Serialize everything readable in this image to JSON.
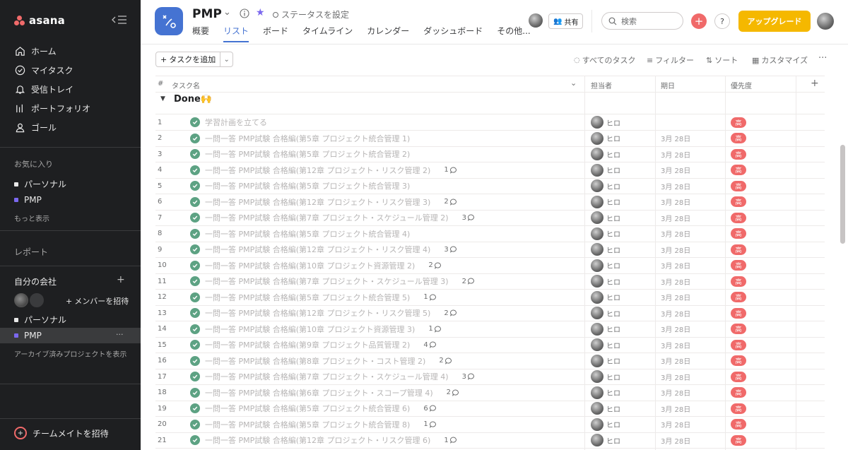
{
  "sidebar": {
    "logo_text": "asana",
    "nav": [
      {
        "label": "ホーム",
        "icon": "home-icon"
      },
      {
        "label": "マイタスク",
        "icon": "check-circle-icon"
      },
      {
        "label": "受信トレイ",
        "icon": "bell-icon"
      },
      {
        "label": "ポートフォリオ",
        "icon": "bar-chart-icon"
      },
      {
        "label": "ゴール",
        "icon": "person-icon"
      }
    ],
    "favorites_label": "お気に入り",
    "favorites": [
      {
        "label": "パーソナル",
        "color": "#e8e8e8"
      },
      {
        "label": "PMP",
        "color": "#7b68ee"
      }
    ],
    "show_more": "もっと表示",
    "reports_label": "レポート",
    "team_label": "自分の会社",
    "invite_member": "メンバーを招待",
    "team_projects": [
      {
        "label": "パーソナル",
        "color": "#e8e8e8"
      },
      {
        "label": "PMP",
        "color": "#7b68ee"
      }
    ],
    "archived_link": "アーカイブ済みプロジェクトを表示",
    "invite_teammates": "チームメイトを招待"
  },
  "header": {
    "project_title": "PMP",
    "status_label": "ステータスを設定",
    "tabs": [
      "概要",
      "リスト",
      "ボード",
      "タイムライン",
      "カレンダー",
      "ダッシュボード",
      "その他..."
    ],
    "active_tab": "リスト",
    "share_label": "共有",
    "search_placeholder": "検索",
    "help_label": "?",
    "upgrade_label": "アップグレード",
    "accent": "#4573d2",
    "upgrade_color": "#f5b800"
  },
  "toolbar": {
    "add_task": "タスクを追加",
    "all_tasks": "すべてのタスク",
    "filter": "フィルター",
    "sort": "ソート",
    "customize": "カスタマイズ",
    "more": "···"
  },
  "table": {
    "headers": {
      "num": "#",
      "name": "タスク名",
      "assignee": "担当者",
      "due": "期日",
      "priority": "優先度",
      "add": "+"
    },
    "section_name": "Done🙌",
    "rows": [
      {
        "num": "1",
        "name": "学習計画を立てる",
        "comments": "",
        "assignee": "ヒロ",
        "due": "",
        "priority": "高"
      },
      {
        "num": "2",
        "name": "一問一答 PMP試験 合格編(第5章 プロジェクト統合管理 1)",
        "comments": "",
        "assignee": "ヒロ",
        "due": "3月 28日",
        "priority": "高"
      },
      {
        "num": "3",
        "name": "一問一答 PMP試験 合格編(第5章 プロジェクト統合管理 2)",
        "comments": "",
        "assignee": "ヒロ",
        "due": "3月 28日",
        "priority": "高"
      },
      {
        "num": "4",
        "name": "一問一答 PMP試験 合格編(第12章 プロジェクト・リスク管理 2)",
        "comments": "1",
        "assignee": "ヒロ",
        "due": "3月 28日",
        "priority": "高"
      },
      {
        "num": "5",
        "name": "一問一答 PMP試験 合格編(第5章 プロジェクト統合管理 3)",
        "comments": "",
        "assignee": "ヒロ",
        "due": "3月 28日",
        "priority": "高"
      },
      {
        "num": "6",
        "name": "一問一答 PMP試験 合格編(第12章 プロジェクト・リスク管理 3)",
        "comments": "2",
        "assignee": "ヒロ",
        "due": "3月 28日",
        "priority": "高"
      },
      {
        "num": "7",
        "name": "一問一答 PMP試験 合格編(第7章 プロジェクト・スケジュール管理 2)",
        "comments": "3",
        "assignee": "ヒロ",
        "due": "3月 28日",
        "priority": "高"
      },
      {
        "num": "8",
        "name": "一問一答 PMP試験 合格編(第5章 プロジェクト統合管理 4)",
        "comments": "",
        "assignee": "ヒロ",
        "due": "3月 28日",
        "priority": "高"
      },
      {
        "num": "9",
        "name": "一問一答 PMP試験 合格編(第12章 プロジェクト・リスク管理 4)",
        "comments": "3",
        "assignee": "ヒロ",
        "due": "3月 28日",
        "priority": "高"
      },
      {
        "num": "10",
        "name": "一問一答 PMP試験 合格編(第10章 プロジェクト資源管理 2)",
        "comments": "2",
        "assignee": "ヒロ",
        "due": "3月 28日",
        "priority": "高"
      },
      {
        "num": "11",
        "name": "一問一答 PMP試験 合格編(第7章 プロジェクト・スケジュール管理 3)",
        "comments": "2",
        "assignee": "ヒロ",
        "due": "3月 28日",
        "priority": "高"
      },
      {
        "num": "12",
        "name": "一問一答 PMP試験 合格編(第5章 プロジェクト統合管理 5)",
        "comments": "1",
        "assignee": "ヒロ",
        "due": "3月 28日",
        "priority": "高"
      },
      {
        "num": "13",
        "name": "一問一答 PMP試験 合格編(第12章 プロジェクト・リスク管理 5)",
        "comments": "2",
        "assignee": "ヒロ",
        "due": "3月 28日",
        "priority": "高"
      },
      {
        "num": "14",
        "name": "一問一答 PMP試験 合格編(第10章 プロジェクト資源管理 3)",
        "comments": "1",
        "assignee": "ヒロ",
        "due": "3月 28日",
        "priority": "高"
      },
      {
        "num": "15",
        "name": "一問一答 PMP試験 合格編(第9章 プロジェクト品質管理 2)",
        "comments": "4",
        "assignee": "ヒロ",
        "due": "3月 28日",
        "priority": "高"
      },
      {
        "num": "16",
        "name": "一問一答 PMP試験 合格編(第8章 プロジェクト・コスト管理 2)",
        "comments": "2",
        "assignee": "ヒロ",
        "due": "3月 28日",
        "priority": "高"
      },
      {
        "num": "17",
        "name": "一問一答 PMP試験 合格編(第7章 プロジェクト・スケジュール管理 4)",
        "comments": "3",
        "assignee": "ヒロ",
        "due": "3月 28日",
        "priority": "高"
      },
      {
        "num": "18",
        "name": "一問一答 PMP試験 合格編(第6章 プロジェクト・スコープ管理 4)",
        "comments": "2",
        "assignee": "ヒロ",
        "due": "3月 28日",
        "priority": "高"
      },
      {
        "num": "19",
        "name": "一問一答 PMP試験 合格編(第5章 プロジェクト統合管理 6)",
        "comments": "6",
        "assignee": "ヒロ",
        "due": "3月 28日",
        "priority": "高"
      },
      {
        "num": "20",
        "name": "一問一答 PMP試験 合格編(第5章 プロジェクト統合管理 8)",
        "comments": "1",
        "assignee": "ヒロ",
        "due": "3月 28日",
        "priority": "高"
      },
      {
        "num": "21",
        "name": "一問一答 PMP試験 合格編(第12章 プロジェクト・リスク管理 6)",
        "comments": "1",
        "assignee": "ヒロ",
        "due": "3月 28日",
        "priority": "高"
      }
    ]
  }
}
